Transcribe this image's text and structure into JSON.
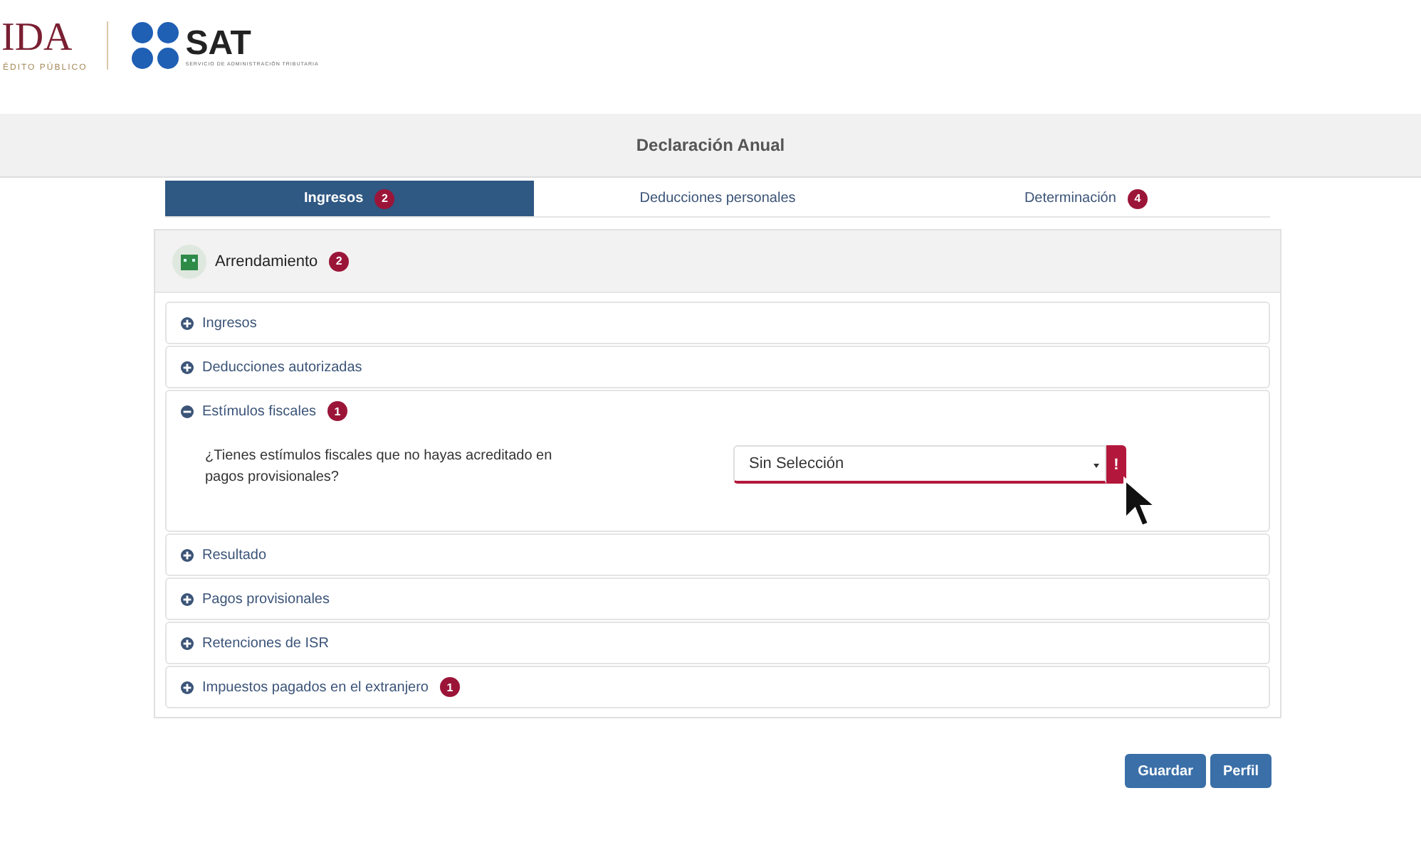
{
  "logos": {
    "left_text": "IDA",
    "left_subtitle": "ÉDITO PÚBLICO",
    "sat_text": "SAT",
    "sat_subtitle": "SERVICIO DE ADMINISTRACIÓN TRIBUTARIA"
  },
  "title": "Declaración Anual",
  "tabs": [
    {
      "label": "Ingresos",
      "badge": "2",
      "selected": true
    },
    {
      "label": "Deducciones personales",
      "selected": false
    },
    {
      "label": "Determinación",
      "badge": "4",
      "selected": false
    }
  ],
  "panel": {
    "title": "Arrendamiento",
    "badge": "2",
    "sections": [
      {
        "label": "Ingresos",
        "expanded": false
      },
      {
        "label": "Deducciones autorizadas",
        "expanded": false
      },
      {
        "label": "Estímulos fiscales",
        "badge": "1",
        "expanded": true,
        "question": "¿Tienes estímulos fiscales que no hayas acreditado en pagos provisionales?",
        "select_value": "Sin Selección",
        "error_mark": "!"
      },
      {
        "label": "Resultado",
        "expanded": false
      },
      {
        "label": "Pagos provisionales",
        "expanded": false
      },
      {
        "label": "Retenciones de ISR",
        "expanded": false
      },
      {
        "label": "Impuestos pagados en el extranjero",
        "badge": "1",
        "expanded": false
      }
    ]
  },
  "buttons": [
    "Guardar",
    "Perfil"
  ]
}
